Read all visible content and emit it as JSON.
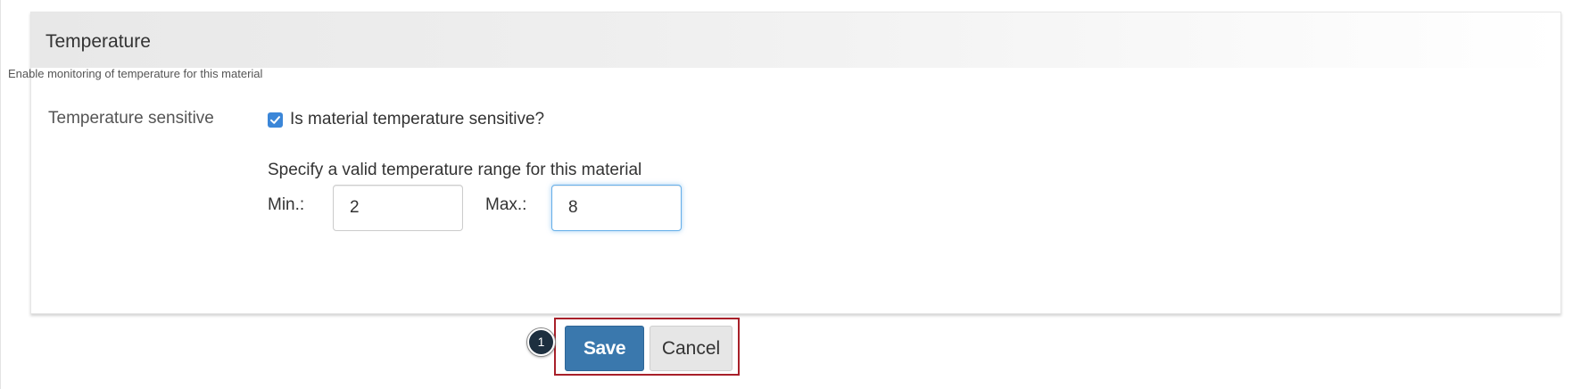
{
  "section": {
    "title": "Temperature",
    "description": "Enable monitoring of temperature for this material"
  },
  "temperature_sensitive": {
    "label": "Temperature sensitive",
    "checkbox_label": "Is material temperature sensitive?",
    "checked": true
  },
  "range": {
    "instruction": "Specify a valid temperature range for this material",
    "min_label": "Min.:",
    "min_value": "2",
    "max_label": "Max.:",
    "max_value": "8"
  },
  "actions": {
    "step_number": "1",
    "save_label": "Save",
    "cancel_label": "Cancel"
  },
  "colors": {
    "save_button": "#3a78ad",
    "checkbox": "#3b86d8",
    "highlight_border": "#a8202a",
    "focus_border": "#66afe9"
  },
  "icons": {
    "checkbox": "check-icon"
  }
}
